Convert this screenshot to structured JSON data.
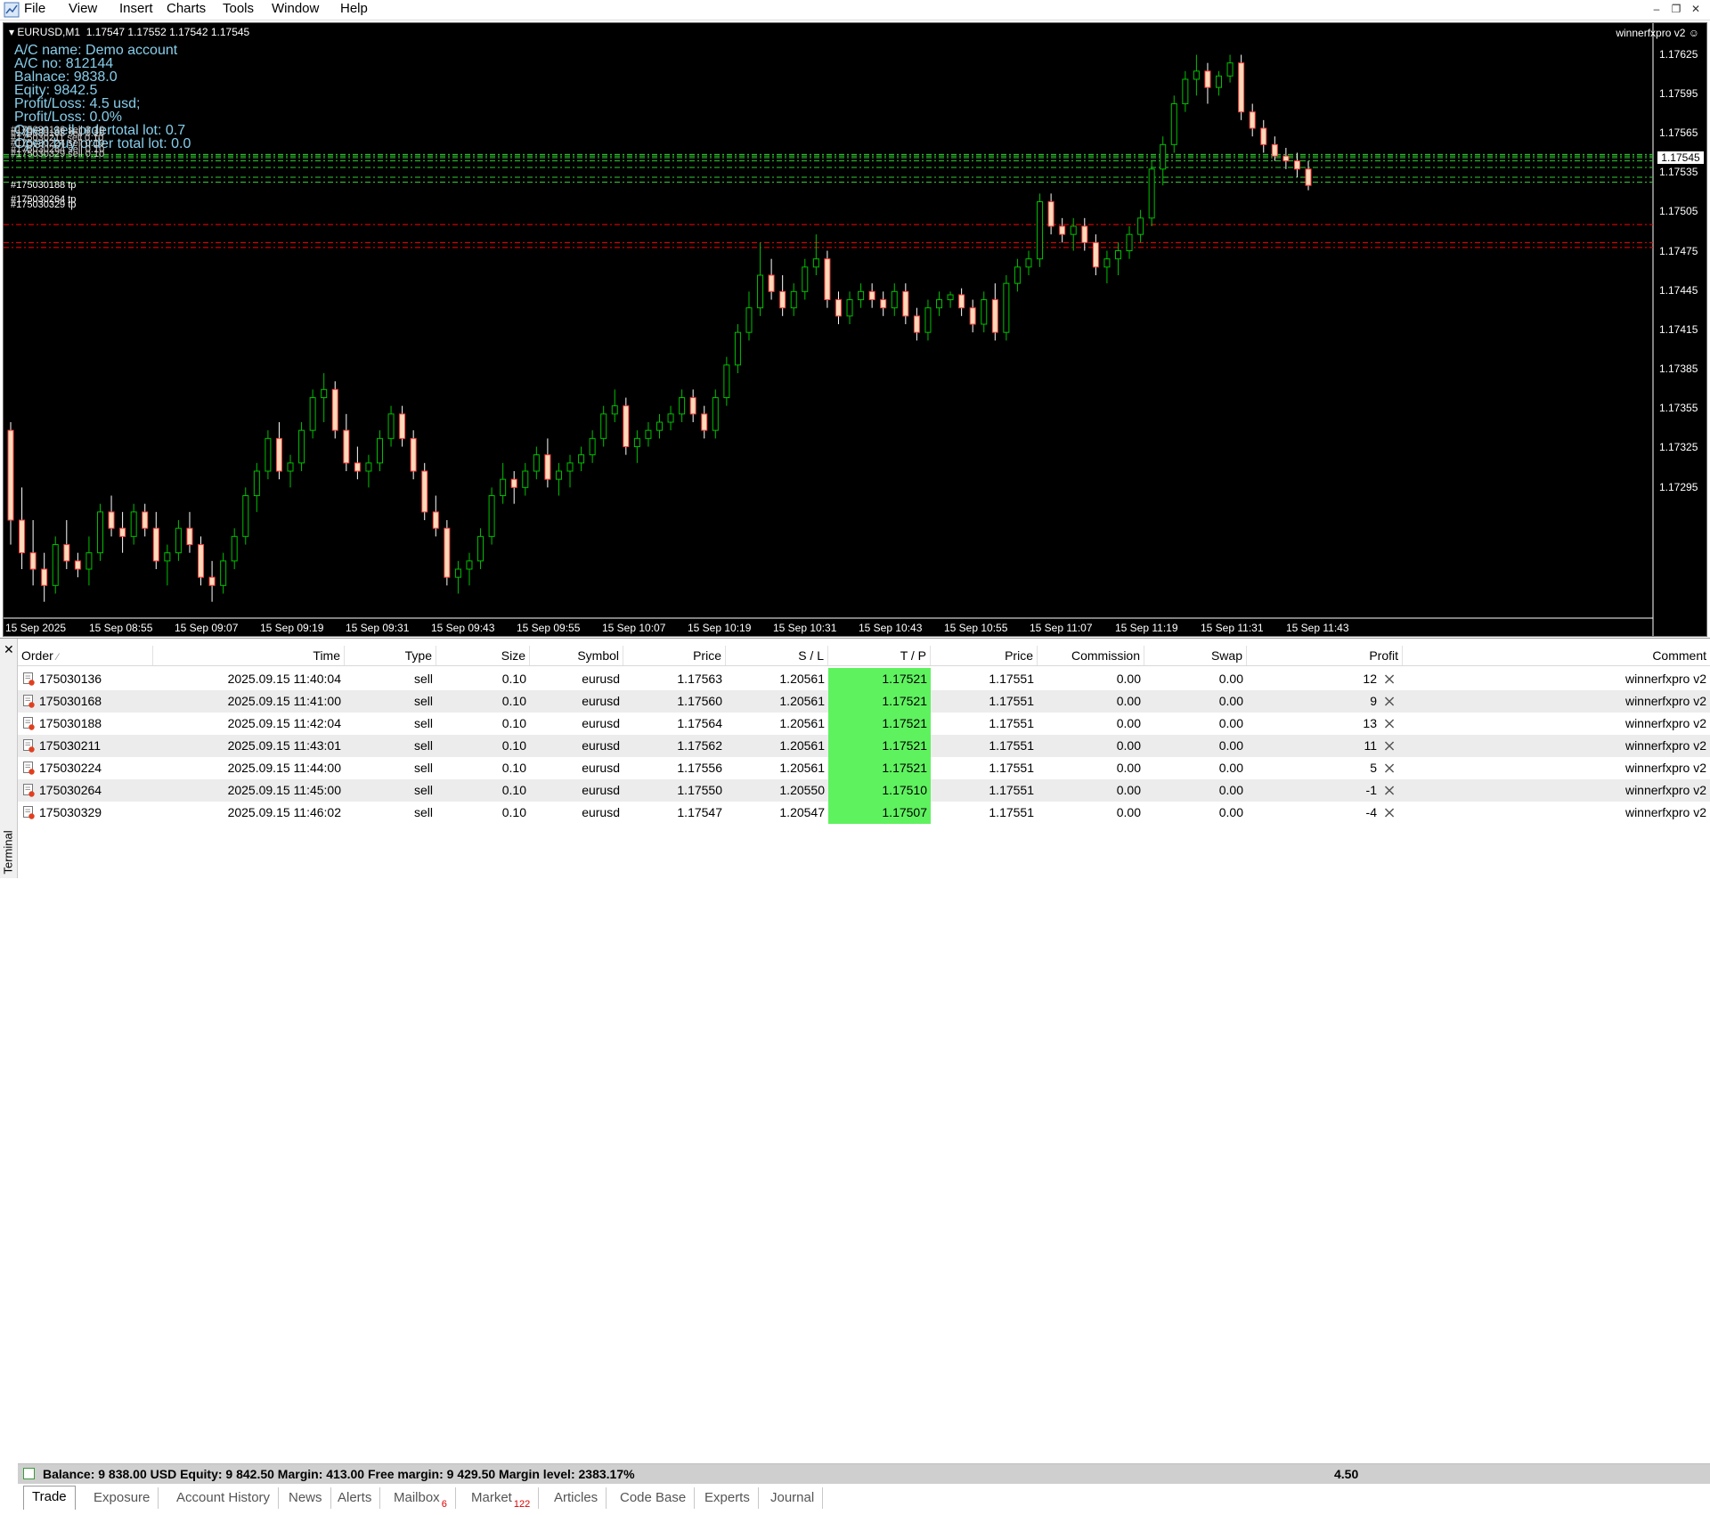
{
  "menu": {
    "items": [
      "File",
      "View",
      "Insert",
      "Charts",
      "Tools",
      "Window",
      "Help"
    ]
  },
  "chart": {
    "header": "EURUSD,M1  1.17547 1.17552 1.17542 1.17545",
    "ea_name": "winnerfxpro v2",
    "info": [
      "A/C name: Demo account",
      "A/C no: 812144",
      "Balnace: 9838.0",
      "Eqity: 9842.5",
      "Profit/Loss: 4.5 usd;",
      "Profit/Loss: 0.0%",
      "Open sell ordertotal lot: 0.7",
      "Open buy order total lot: 0.0"
    ],
    "order_labels": [
      "#175030136 sell 0.10",
      "#175030168 sell 0.10",
      "#175030211 sell 0.10",
      "#175030224 sell 0.10",
      "#175030264 sell 0.10",
      "#175030329 sell 0.10"
    ],
    "tp_labels": [
      "#175030188 tp",
      "#175030264 tp",
      "#175030329 tp"
    ],
    "price_ticks": [
      "1.17625",
      "1.17595",
      "1.17565",
      "1.17535",
      "1.17505",
      "1.17475",
      "1.17445",
      "1.17415",
      "1.17385",
      "1.17355",
      "1.17325",
      "1.17295"
    ],
    "current_price": "1.17545",
    "time_ticks": [
      "15 Sep 2025",
      "15 Sep 08:55",
      "15 Sep 09:07",
      "15 Sep 09:19",
      "15 Sep 09:31",
      "15 Sep 09:43",
      "15 Sep 09:55",
      "15 Sep 10:07",
      "15 Sep 10:19",
      "15 Sep 10:31",
      "15 Sep 10:43",
      "15 Sep 10:55",
      "15 Sep 11:07",
      "15 Sep 11:19",
      "15 Sep 11:31",
      "15 Sep 11:43"
    ],
    "colors": {
      "bull": "#00c000",
      "bear": "#ffdab9",
      "sell_line": "#32cd32",
      "tp_line": "#ff0000",
      "info_text": "#87ceeb"
    },
    "candles": [
      [
        1.17395,
        1.174,
        1.17325,
        1.1734
      ],
      [
        1.1734,
        1.1736,
        1.1731,
        1.1732
      ],
      [
        1.1732,
        1.1734,
        1.173,
        1.1731
      ],
      [
        1.1731,
        1.1732,
        1.1729,
        1.173
      ],
      [
        1.173,
        1.1733,
        1.17295,
        1.17325
      ],
      [
        1.17325,
        1.1734,
        1.1731,
        1.17315
      ],
      [
        1.17315,
        1.1732,
        1.17305,
        1.1731
      ],
      [
        1.1731,
        1.1733,
        1.173,
        1.1732
      ],
      [
        1.1732,
        1.1735,
        1.17315,
        1.17345
      ],
      [
        1.17345,
        1.17355,
        1.1733,
        1.17335
      ],
      [
        1.17335,
        1.17345,
        1.1732,
        1.1733
      ],
      [
        1.1733,
        1.1735,
        1.17325,
        1.17345
      ],
      [
        1.17345,
        1.1735,
        1.1733,
        1.17335
      ],
      [
        1.17335,
        1.17345,
        1.1731,
        1.17315
      ],
      [
        1.17315,
        1.17325,
        1.173,
        1.1732
      ],
      [
        1.1732,
        1.1734,
        1.17315,
        1.17335
      ],
      [
        1.17335,
        1.17345,
        1.1732,
        1.17325
      ],
      [
        1.17325,
        1.1733,
        1.173,
        1.17305
      ],
      [
        1.17305,
        1.17315,
        1.1729,
        1.173
      ],
      [
        1.173,
        1.1732,
        1.17295,
        1.17315
      ],
      [
        1.17315,
        1.17335,
        1.1731,
        1.1733
      ],
      [
        1.1733,
        1.1736,
        1.17325,
        1.17355
      ],
      [
        1.17355,
        1.17375,
        1.17345,
        1.1737
      ],
      [
        1.1737,
        1.17395,
        1.17365,
        1.1739
      ],
      [
        1.1739,
        1.174,
        1.17365,
        1.1737
      ],
      [
        1.1737,
        1.1738,
        1.1736,
        1.17375
      ],
      [
        1.17375,
        1.174,
        1.1737,
        1.17395
      ],
      [
        1.17395,
        1.1742,
        1.1739,
        1.17415
      ],
      [
        1.17415,
        1.1743,
        1.174,
        1.1742
      ],
      [
        1.1742,
        1.17425,
        1.1739,
        1.17395
      ],
      [
        1.17395,
        1.17405,
        1.1737,
        1.17375
      ],
      [
        1.17375,
        1.17385,
        1.17365,
        1.1737
      ],
      [
        1.1737,
        1.1738,
        1.1736,
        1.17375
      ],
      [
        1.17375,
        1.17395,
        1.1737,
        1.1739
      ],
      [
        1.1739,
        1.1741,
        1.17385,
        1.17405
      ],
      [
        1.17405,
        1.1741,
        1.17385,
        1.1739
      ],
      [
        1.1739,
        1.17395,
        1.17365,
        1.1737
      ],
      [
        1.1737,
        1.17375,
        1.1734,
        1.17345
      ],
      [
        1.17345,
        1.17355,
        1.1733,
        1.17335
      ],
      [
        1.17335,
        1.1734,
        1.173,
        1.17305
      ],
      [
        1.17305,
        1.17315,
        1.17295,
        1.1731
      ],
      [
        1.1731,
        1.1732,
        1.173,
        1.17315
      ],
      [
        1.17315,
        1.17335,
        1.1731,
        1.1733
      ],
      [
        1.1733,
        1.1736,
        1.17325,
        1.17355
      ],
      [
        1.17355,
        1.17375,
        1.1735,
        1.17365
      ],
      [
        1.17365,
        1.1737,
        1.1735,
        1.1736
      ],
      [
        1.1736,
        1.17375,
        1.17355,
        1.1737
      ],
      [
        1.1737,
        1.17385,
        1.17365,
        1.1738
      ],
      [
        1.1738,
        1.1739,
        1.1736,
        1.17365
      ],
      [
        1.17365,
        1.17375,
        1.17355,
        1.1737
      ],
      [
        1.1737,
        1.1738,
        1.1736,
        1.17375
      ],
      [
        1.17375,
        1.17385,
        1.1737,
        1.1738
      ],
      [
        1.1738,
        1.17395,
        1.17375,
        1.1739
      ],
      [
        1.1739,
        1.1741,
        1.17385,
        1.17405
      ],
      [
        1.17405,
        1.1742,
        1.174,
        1.1741
      ],
      [
        1.1741,
        1.17415,
        1.1738,
        1.17385
      ],
      [
        1.17385,
        1.17395,
        1.17375,
        1.1739
      ],
      [
        1.1739,
        1.174,
        1.17385,
        1.17395
      ],
      [
        1.17395,
        1.17405,
        1.1739,
        1.174
      ],
      [
        1.174,
        1.1741,
        1.17395,
        1.17405
      ],
      [
        1.17405,
        1.1742,
        1.174,
        1.17415
      ],
      [
        1.17415,
        1.1742,
        1.174,
        1.17405
      ],
      [
        1.17405,
        1.1741,
        1.1739,
        1.17395
      ],
      [
        1.17395,
        1.1742,
        1.1739,
        1.17415
      ],
      [
        1.17415,
        1.1744,
        1.1741,
        1.17435
      ],
      [
        1.17435,
        1.1746,
        1.1743,
        1.17455
      ],
      [
        1.17455,
        1.1748,
        1.1745,
        1.1747
      ],
      [
        1.1747,
        1.1751,
        1.17465,
        1.1749
      ],
      [
        1.1749,
        1.175,
        1.17475,
        1.1748
      ],
      [
        1.1748,
        1.1749,
        1.17465,
        1.1747
      ],
      [
        1.1747,
        1.17485,
        1.17465,
        1.1748
      ],
      [
        1.1748,
        1.175,
        1.17475,
        1.17495
      ],
      [
        1.17495,
        1.17515,
        1.1749,
        1.175
      ],
      [
        1.175,
        1.17505,
        1.1747,
        1.17475
      ],
      [
        1.17475,
        1.1748,
        1.1746,
        1.17465
      ],
      [
        1.17465,
        1.1748,
        1.1746,
        1.17475
      ],
      [
        1.17475,
        1.17485,
        1.1747,
        1.1748
      ],
      [
        1.1748,
        1.17485,
        1.1747,
        1.17475
      ],
      [
        1.17475,
        1.1748,
        1.17465,
        1.1747
      ],
      [
        1.1747,
        1.17485,
        1.17465,
        1.1748
      ],
      [
        1.1748,
        1.17485,
        1.1746,
        1.17465
      ],
      [
        1.17465,
        1.1747,
        1.1745,
        1.17455
      ],
      [
        1.17455,
        1.17475,
        1.1745,
        1.1747
      ],
      [
        1.1747,
        1.1748,
        1.17465,
        1.17475
      ],
      [
        1.17475,
        1.1748,
        1.1747,
        1.17478
      ],
      [
        1.17478,
        1.17482,
        1.17465,
        1.1747
      ],
      [
        1.1747,
        1.17475,
        1.17455,
        1.1746
      ],
      [
        1.1746,
        1.1748,
        1.17455,
        1.17475
      ],
      [
        1.17475,
        1.17485,
        1.1745,
        1.17455
      ],
      [
        1.17455,
        1.1749,
        1.1745,
        1.17485
      ],
      [
        1.17485,
        1.175,
        1.1748,
        1.17495
      ],
      [
        1.17495,
        1.17505,
        1.1749,
        1.175
      ],
      [
        1.175,
        1.1754,
        1.17495,
        1.17535
      ],
      [
        1.17535,
        1.1754,
        1.17515,
        1.1752
      ],
      [
        1.1752,
        1.17525,
        1.1751,
        1.17515
      ],
      [
        1.17515,
        1.17525,
        1.17505,
        1.1752
      ],
      [
        1.1752,
        1.17525,
        1.17505,
        1.1751
      ],
      [
        1.1751,
        1.17515,
        1.1749,
        1.17495
      ],
      [
        1.17495,
        1.17505,
        1.17485,
        1.175
      ],
      [
        1.175,
        1.1751,
        1.1749,
        1.17505
      ],
      [
        1.17505,
        1.1752,
        1.175,
        1.17515
      ],
      [
        1.17515,
        1.1753,
        1.1751,
        1.17525
      ],
      [
        1.17525,
        1.1756,
        1.1752,
        1.17555
      ],
      [
        1.17555,
        1.17575,
        1.17545,
        1.1757
      ],
      [
        1.1757,
        1.176,
        1.17565,
        1.17595
      ],
      [
        1.17595,
        1.17615,
        1.1759,
        1.1761
      ],
      [
        1.1761,
        1.17625,
        1.176,
        1.17615
      ],
      [
        1.17615,
        1.1762,
        1.17595,
        1.17605
      ],
      [
        1.17605,
        1.17615,
        1.176,
        1.17612
      ],
      [
        1.17612,
        1.17625,
        1.17608,
        1.1762
      ],
      [
        1.1762,
        1.17625,
        1.17585,
        1.1759
      ],
      [
        1.1759,
        1.17595,
        1.17575,
        1.1758
      ],
      [
        1.1758,
        1.17585,
        1.17565,
        1.1757
      ],
      [
        1.1757,
        1.17575,
        1.1756,
        1.17563
      ],
      [
        1.17563,
        1.17568,
        1.17555,
        1.1756
      ],
      [
        1.1756,
        1.17565,
        1.1755,
        1.17555
      ],
      [
        1.17555,
        1.1756,
        1.17542,
        1.17545
      ]
    ],
    "sell_lines": [
      1.17563,
      1.1756,
      1.17564,
      1.17562,
      1.17556,
      1.1755,
      1.17547
    ],
    "tp_lines": [
      1.17521,
      1.1751,
      1.17507
    ],
    "ylim": [
      1.1728,
      1.1764
    ]
  },
  "terminal": {
    "title": "Terminal",
    "close_glyph": "✕",
    "columns": [
      "Order",
      "Time",
      "Type",
      "Size",
      "Symbol",
      "Price",
      "S / L",
      "T / P",
      "Price",
      "Commission",
      "Swap",
      "Profit",
      "Comment"
    ],
    "sort_glyph": "⁄",
    "rows": [
      {
        "order": "175030136",
        "time": "2025.09.15 11:40:04",
        "type": "sell",
        "size": "0.10",
        "symbol": "eurusd",
        "price": "1.17563",
        "sl": "1.20561",
        "tp": "1.17521",
        "cur": "1.17551",
        "commission": "0.00",
        "swap": "0.00",
        "profit": "12",
        "comment": "winnerfxpro v2"
      },
      {
        "order": "175030168",
        "time": "2025.09.15 11:41:00",
        "type": "sell",
        "size": "0.10",
        "symbol": "eurusd",
        "price": "1.17560",
        "sl": "1.20561",
        "tp": "1.17521",
        "cur": "1.17551",
        "commission": "0.00",
        "swap": "0.00",
        "profit": "9",
        "comment": "winnerfxpro v2"
      },
      {
        "order": "175030188",
        "time": "2025.09.15 11:42:04",
        "type": "sell",
        "size": "0.10",
        "symbol": "eurusd",
        "price": "1.17564",
        "sl": "1.20561",
        "tp": "1.17521",
        "cur": "1.17551",
        "commission": "0.00",
        "swap": "0.00",
        "profit": "13",
        "comment": "winnerfxpro v2"
      },
      {
        "order": "175030211",
        "time": "2025.09.15 11:43:01",
        "type": "sell",
        "size": "0.10",
        "symbol": "eurusd",
        "price": "1.17562",
        "sl": "1.20561",
        "tp": "1.17521",
        "cur": "1.17551",
        "commission": "0.00",
        "swap": "0.00",
        "profit": "11",
        "comment": "winnerfxpro v2"
      },
      {
        "order": "175030224",
        "time": "2025.09.15 11:44:00",
        "type": "sell",
        "size": "0.10",
        "symbol": "eurusd",
        "price": "1.17556",
        "sl": "1.20561",
        "tp": "1.17521",
        "cur": "1.17551",
        "commission": "0.00",
        "swap": "0.00",
        "profit": "5",
        "comment": "winnerfxpro v2"
      },
      {
        "order": "175030264",
        "time": "2025.09.15 11:45:00",
        "type": "sell",
        "size": "0.10",
        "symbol": "eurusd",
        "price": "1.17550",
        "sl": "1.20550",
        "tp": "1.17510",
        "cur": "1.17551",
        "commission": "0.00",
        "swap": "0.00",
        "profit": "-1",
        "comment": "winnerfxpro v2"
      },
      {
        "order": "175030329",
        "time": "2025.09.15 11:46:02",
        "type": "sell",
        "size": "0.10",
        "symbol": "eurusd",
        "price": "1.17547",
        "sl": "1.20547",
        "tp": "1.17507",
        "cur": "1.17551",
        "commission": "0.00",
        "swap": "0.00",
        "profit": "-4",
        "comment": "winnerfxpro v2"
      }
    ],
    "balance_text": "Balance: 9 838.00 USD  Equity: 9 842.50  Margin: 413.00  Free margin: 9 429.50  Margin level: 2383.17%",
    "total_profit": "4.50",
    "tabs": [
      {
        "label": "Trade",
        "badge": ""
      },
      {
        "label": "Exposure",
        "badge": ""
      },
      {
        "label": "Account History",
        "badge": ""
      },
      {
        "label": "News",
        "badge": ""
      },
      {
        "label": "Alerts",
        "badge": ""
      },
      {
        "label": "Mailbox",
        "badge": "6"
      },
      {
        "label": "Market",
        "badge": "122"
      },
      {
        "label": "Articles",
        "badge": ""
      },
      {
        "label": "Code Base",
        "badge": ""
      },
      {
        "label": "Experts",
        "badge": ""
      },
      {
        "label": "Journal",
        "badge": ""
      }
    ]
  }
}
